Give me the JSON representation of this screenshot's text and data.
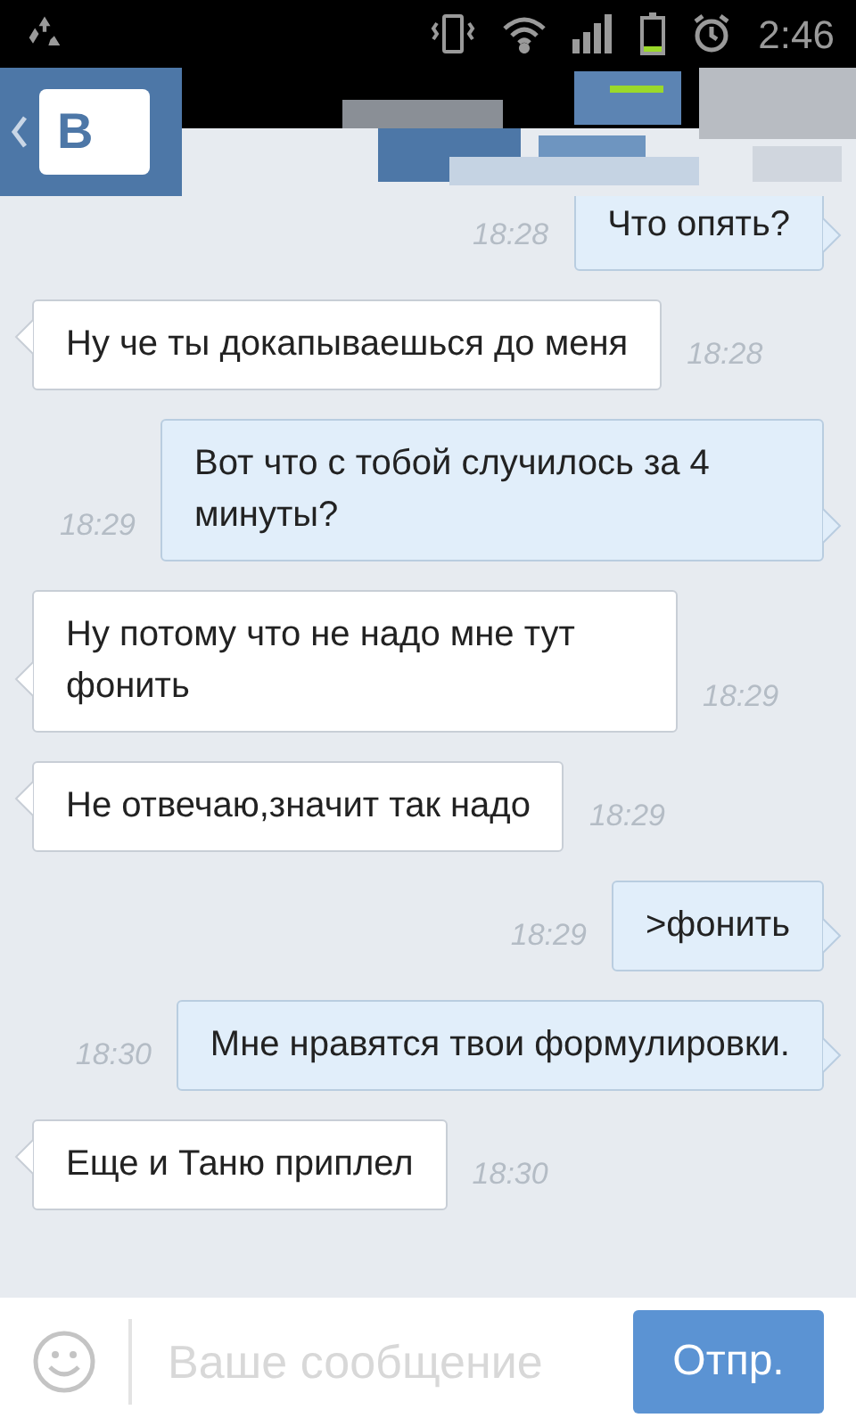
{
  "status_bar": {
    "time": "2:46"
  },
  "header": {
    "logo": "В"
  },
  "messages": [
    {
      "text": "Что опять?",
      "time": "18:28",
      "outgoing": true
    },
    {
      "text": "Ну че ты докапываешься до меня",
      "time": "18:28",
      "outgoing": false
    },
    {
      "text": "Вот что с тобой случилось за 4 минуты?",
      "time": "18:29",
      "outgoing": true
    },
    {
      "text": "Ну потому что не надо мне тут фонить",
      "time": "18:29",
      "outgoing": false
    },
    {
      "text": "Не отвечаю,значит так надо",
      "time": "18:29",
      "outgoing": false
    },
    {
      "text": ">фонить",
      "time": "18:29",
      "outgoing": true
    },
    {
      "text": "Мне нравятся твои формулировки.",
      "time": "18:30",
      "outgoing": true
    },
    {
      "text": "Еще и Таню приплел",
      "time": "18:30",
      "outgoing": false
    }
  ],
  "composer": {
    "placeholder": "Ваше сообщение",
    "send_button": "Отпр."
  }
}
